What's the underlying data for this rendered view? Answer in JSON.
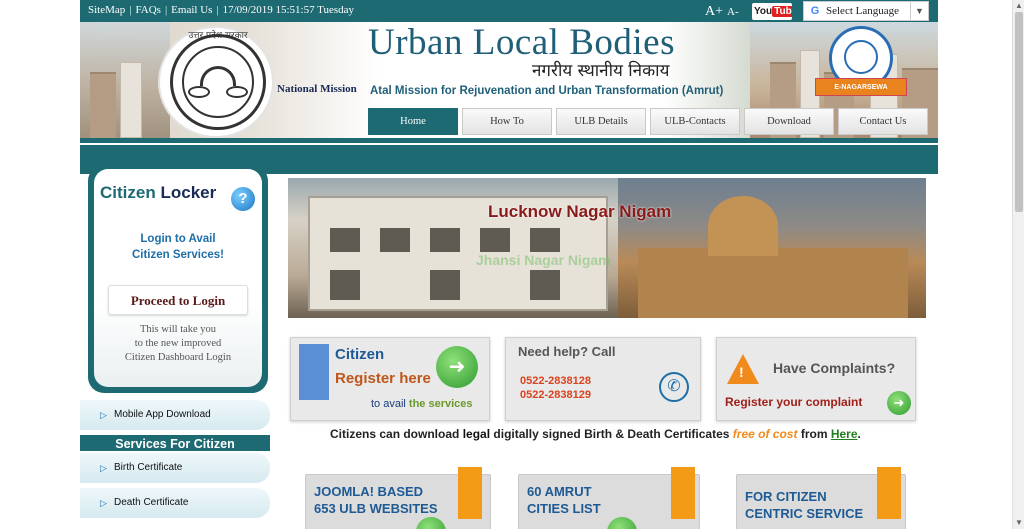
{
  "topbar": {
    "links": [
      "SiteMap",
      "FAQs",
      "Email Us"
    ],
    "datetime": "17/09/2019 15:51:57 Tuesday",
    "font_increase": "A+",
    "font_decrease": "A-",
    "youtube_you": "You",
    "youtube_tube": "Tube",
    "language_select": "Select Language",
    "language_g": "G"
  },
  "header": {
    "title": "Urban Local Bodies",
    "hindi_title": "नगरीय स्थानीय निकाय",
    "national_mission": "National Mission",
    "subtitle": "Atal Mission for Rejuvenation and Urban Transformation (Amrut)",
    "emblem_hindi": "उत्तर प्रदेश सरकार",
    "badge_ribbon": "E-NAGARSEWA"
  },
  "nav": {
    "items": [
      "Home",
      "How To",
      "ULB Details",
      "ULB-Contacts",
      "Download",
      "Contact Us"
    ],
    "active": "Home"
  },
  "locker": {
    "title_a": "Citizen",
    "title_b": "Locker",
    "login_line1": "Login to Avail",
    "login_line2": "Citizen Services!",
    "proceed": "Proceed to Login",
    "note1": "This will take you",
    "note2": "to the new improved",
    "note3": "Citizen Dashboard Login"
  },
  "sidebar": {
    "mobile_app": "Mobile App Download",
    "services_heading": "Services For Citizen",
    "birth": "Birth Certificate",
    "death": "Death Certificate"
  },
  "slider": {
    "caption1": "Lucknow Nagar Nigam",
    "caption2": "Jhansi Nagar Nigam"
  },
  "cards": {
    "register": {
      "line1": "Citizen",
      "line2": "Register here",
      "line3a": "to avail",
      "line3b": "the services"
    },
    "help": {
      "title": "Need help? Call",
      "phone1": "0522-2838128",
      "phone2": "0522-2838129"
    },
    "complaint": {
      "title": "Have Complaints?",
      "action": "Register your complaint"
    }
  },
  "notice": {
    "prefix": "Citizens can download",
    "legal": "legal",
    "middle": "digitally signed Birth & Death Certificates",
    "free": "free of cost",
    "from": "from",
    "link": "Here",
    "end": "."
  },
  "bottom_cards": {
    "joomla1": "JOOMLA! BASED",
    "joomla2": "653 ULB WEBSITES",
    "amrut1": "60 AMRUT",
    "amrut2": "CITIES LIST",
    "citizen1": "FOR CITIZEN",
    "citizen2": "CENTRIC SERVICE"
  },
  "colors": {
    "teal": "#1e6a72",
    "accent_orange": "#f08a1c",
    "green": "#2e9a2e"
  }
}
